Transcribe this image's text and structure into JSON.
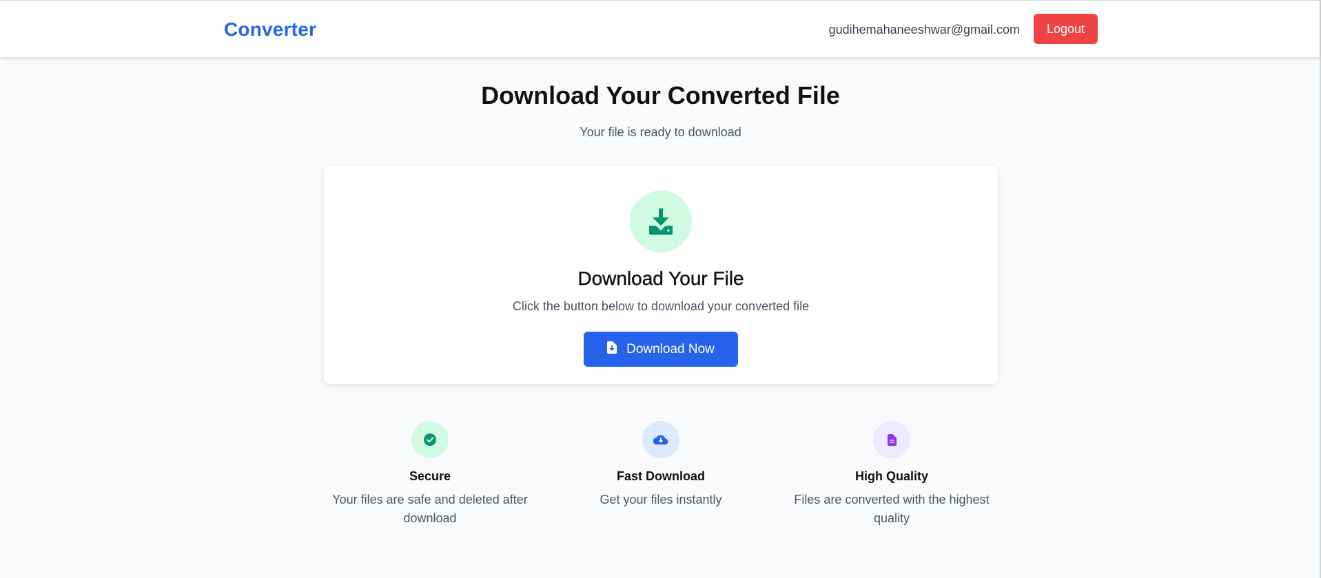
{
  "header": {
    "brand": "Converter",
    "user_email": "gudihemahaneeshwar@gmail.com",
    "logout_label": "Logout"
  },
  "main": {
    "title": "Download Your Converted File",
    "subtitle": "Your file is ready to download"
  },
  "card": {
    "icon": "download-icon",
    "title": "Download Your File",
    "description": "Click the button below to download your converted file",
    "button_label": "Download Now",
    "button_icon": "file-download-icon"
  },
  "features": [
    {
      "icon": "check-circle-icon",
      "title": "Secure",
      "description": "Your files are safe and deleted after download"
    },
    {
      "icon": "cloud-download-icon",
      "title": "Fast Download",
      "description": "Get your files instantly"
    },
    {
      "icon": "document-icon",
      "title": "High Quality",
      "description": "Files are converted with the highest quality"
    }
  ],
  "colors": {
    "brand": "#2563eb",
    "logout": "#ef4444",
    "primary_button": "#2563eb",
    "success_bg": "#d1fae5",
    "success": "#059669",
    "info_bg": "#dbeafe",
    "quality_bg": "#ede9fe",
    "quality": "#9333ea"
  }
}
